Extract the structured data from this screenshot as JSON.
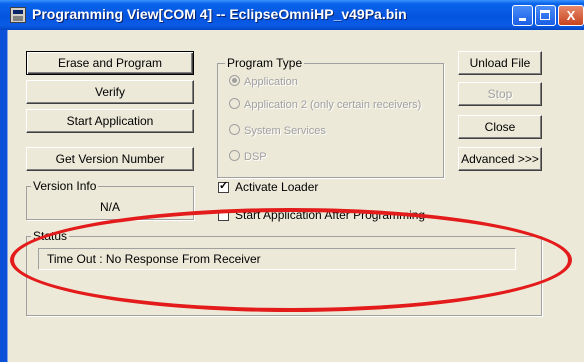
{
  "window": {
    "title": "Programming View[COM 4] -- EclipseOmniHP_v49Pa.bin",
    "controls": {
      "minimize": "_",
      "maximize": "□",
      "close": "X"
    }
  },
  "buttons": {
    "erase_program": "Erase and Program",
    "verify": "Verify",
    "start_application": "Start Application",
    "get_version": "Get Version Number",
    "unload_file": "Unload File",
    "stop": "Stop",
    "close": "Close",
    "advanced": "Advanced >>>"
  },
  "program_type": {
    "label": "Program Type",
    "options": [
      {
        "label": "Application",
        "checked": true
      },
      {
        "label": "Application 2 (only certain receivers)",
        "checked": false
      },
      {
        "label": "System Services",
        "checked": false
      },
      {
        "label": "DSP",
        "checked": false
      }
    ]
  },
  "version_info": {
    "label": "Version Info",
    "value": "N/A"
  },
  "checkboxes": {
    "activate_loader": {
      "label": "Activate Loader",
      "checked": true,
      "mark": "✓"
    },
    "start_after": {
      "label": "Start Application After Programming",
      "checked": false
    }
  },
  "status": {
    "label": "Status",
    "text": "Time Out : No Response From Receiver"
  },
  "colors": {
    "titlebar": "#0554e0",
    "face": "#ece9d8",
    "highlight": "#e41b1b"
  }
}
